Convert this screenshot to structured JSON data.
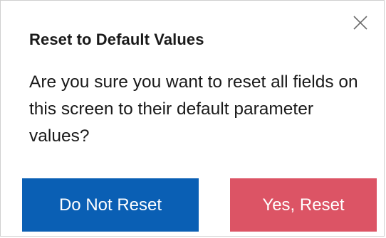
{
  "dialog": {
    "title": "Reset to Default Values",
    "message": "Are you sure you want to reset all fields on this screen to their default parameter values?",
    "close_icon": "close-icon",
    "buttons": {
      "cancel_label": "Do Not Reset",
      "confirm_label": "Yes, Reset"
    }
  },
  "colors": {
    "cancel_button": "#0a5fb4",
    "confirm_button": "#dc5465",
    "text": "#1a1a1a",
    "border": "#cfcfcf"
  }
}
